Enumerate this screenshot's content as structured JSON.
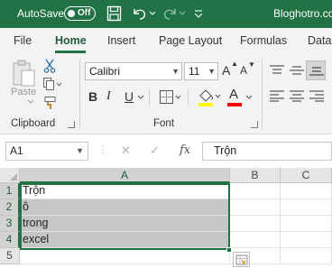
{
  "titlebar": {
    "autosave_label": "AutoSave",
    "autosave_state": "Off",
    "filename": "Bloghotro.com",
    "icons": [
      "save-icon",
      "undo-icon",
      "redo-icon"
    ]
  },
  "tabs": [
    {
      "label": "File"
    },
    {
      "label": "Home",
      "active": true
    },
    {
      "label": "Insert"
    },
    {
      "label": "Page Layout"
    },
    {
      "label": "Formulas"
    },
    {
      "label": "Data"
    }
  ],
  "ribbon": {
    "clipboard": {
      "label": "Clipboard",
      "paste_label": "Paste",
      "icons": [
        "paste-icon",
        "cut-icon",
        "copy-icon",
        "format-painter-icon"
      ]
    },
    "font": {
      "label": "Font",
      "font_name": "Calibri",
      "font_size": "11",
      "grow_label": "A",
      "shrink_label": "A",
      "bold": "B",
      "italic": "I",
      "underline": "U",
      "font_color_label": "A",
      "highlight_color": "#ffff00",
      "font_color": "#ff0000"
    },
    "alignment": {
      "icons": [
        "align-top-icon",
        "align-middle-icon",
        "align-bottom-icon",
        "align-left-icon",
        "align-center-icon",
        "align-right-icon"
      ]
    }
  },
  "formula_bar": {
    "name_box": "A1",
    "fx_label": "fx",
    "cancel_symbol": "✕",
    "enter_symbol": "✓",
    "content": "Trộn"
  },
  "grid": {
    "columns": [
      "A",
      "B",
      "C"
    ],
    "rows": [
      "1",
      "2",
      "3",
      "4",
      "5"
    ],
    "cells": {
      "A1": "Trộn",
      "A2": "ô",
      "A3": "trong",
      "A4": "excel",
      "A5": ""
    },
    "selected_range": "A1:A4",
    "accent_color": "#217346"
  }
}
